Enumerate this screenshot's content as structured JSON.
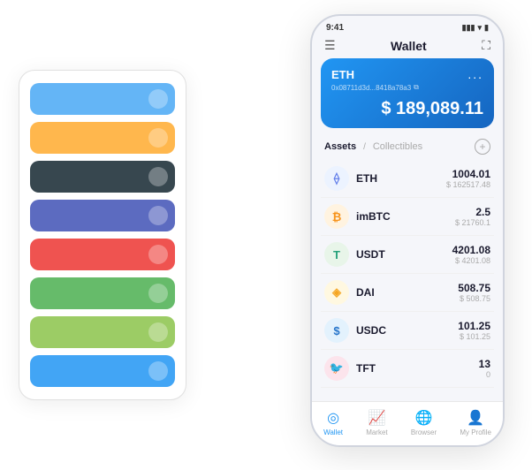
{
  "scene": {
    "background": "#ffffff"
  },
  "cardStack": {
    "cards": [
      {
        "color": "#64B5F6",
        "iconText": "◆"
      },
      {
        "color": "#FFB74D",
        "iconText": "◆"
      },
      {
        "color": "#37474F",
        "iconText": "◆"
      },
      {
        "color": "#5C6BC0",
        "iconText": "◆"
      },
      {
        "color": "#EF5350",
        "iconText": "◆"
      },
      {
        "color": "#66BB6A",
        "iconText": "◆"
      },
      {
        "color": "#9CCC65",
        "iconText": "◆"
      },
      {
        "color": "#42A5F5",
        "iconText": "◆"
      }
    ]
  },
  "phone": {
    "statusBar": {
      "time": "9:41",
      "signal": "▮▮▮",
      "wifi": "WiFi",
      "battery": "🔋"
    },
    "header": {
      "menuIcon": "☰",
      "title": "Wallet",
      "expandIcon": "⛶"
    },
    "ethCard": {
      "label": "ETH",
      "dotsMenu": "...",
      "address": "0x08711d3d...8418a78a3",
      "copyIcon": "⧉",
      "balancePrefix": "$",
      "balance": "189,089.11"
    },
    "assets": {
      "activeTab": "Assets",
      "divider": "/",
      "inactiveTab": "Collectibles",
      "addIcon": "+"
    },
    "assetList": [
      {
        "symbol": "ETH",
        "iconBg": "#ecf3ff",
        "iconColor": "#627EEA",
        "iconChar": "⟠",
        "amount": "1004.01",
        "usd": "$ 162517.48"
      },
      {
        "symbol": "imBTC",
        "iconBg": "#fff3e0",
        "iconColor": "#F7931A",
        "iconChar": "₿",
        "amount": "2.5",
        "usd": "$ 21760.1"
      },
      {
        "symbol": "USDT",
        "iconBg": "#e8f5e9",
        "iconColor": "#26A17B",
        "iconChar": "T",
        "amount": "4201.08",
        "usd": "$ 4201.08"
      },
      {
        "symbol": "DAI",
        "iconBg": "#fff8e1",
        "iconColor": "#F5A623",
        "iconChar": "◈",
        "amount": "508.75",
        "usd": "$ 508.75"
      },
      {
        "symbol": "USDC",
        "iconBg": "#e3f2fd",
        "iconColor": "#2775CA",
        "iconChar": "$",
        "amount": "101.25",
        "usd": "$ 101.25"
      },
      {
        "symbol": "TFT",
        "iconBg": "#fce4ec",
        "iconColor": "#e91e63",
        "iconChar": "🐦",
        "amount": "13",
        "usd": "0"
      }
    ],
    "bottomNav": [
      {
        "icon": "◎",
        "label": "Wallet",
        "active": true
      },
      {
        "icon": "📈",
        "label": "Market",
        "active": false
      },
      {
        "icon": "🌐",
        "label": "Browser",
        "active": false
      },
      {
        "icon": "👤",
        "label": "My Profile",
        "active": false
      }
    ]
  }
}
